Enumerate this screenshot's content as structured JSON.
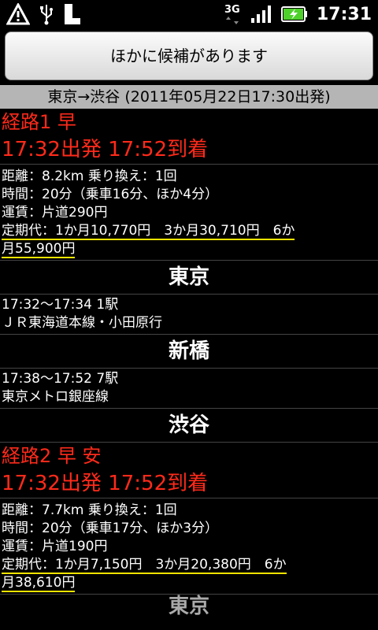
{
  "statusbar": {
    "time": "17:31",
    "icons": [
      "warning-icon",
      "usb-icon",
      "sd-card-icon",
      "3g-icon",
      "signal-icon",
      "battery-charging-icon"
    ],
    "network_label": "3G"
  },
  "other_button": {
    "label": "ほかに候補があります"
  },
  "route_header": "東京→渋谷 (2011年05月22日17:30出発)",
  "routes": [
    {
      "title": "経路1 早",
      "times": "17:32出発 17:52到着",
      "distance": "距離：8.2km 乗り換え：1回",
      "duration": "時間：20分（乗車16分、ほか4分）",
      "fare": "運賃：片道290円",
      "commuter_line1": "定期代：1か月10,770円　3か月30,710円　6か",
      "commuter_line2": "月55,900円",
      "stations": [
        {
          "name": "東京",
          "segment_time": "17:32～17:34 1駅",
          "segment_line": "ＪＲ東海道本線・小田原行"
        },
        {
          "name": "新橋",
          "segment_time": "17:38～17:52 7駅",
          "segment_line": "東京メトロ銀座線"
        },
        {
          "name": "渋谷"
        }
      ]
    },
    {
      "title": "経路2 早 安",
      "times": "17:32出発 17:52到着",
      "distance": "距離：7.7km 乗り換え：1回",
      "duration": "時間：20分（乗車17分、ほか3分）",
      "fare": "運賃：片道190円",
      "commuter_line1": "定期代：1か月7,150円　3か月20,380円　6か",
      "commuter_line2": "月38,610円",
      "next_station": "東京"
    }
  ]
}
